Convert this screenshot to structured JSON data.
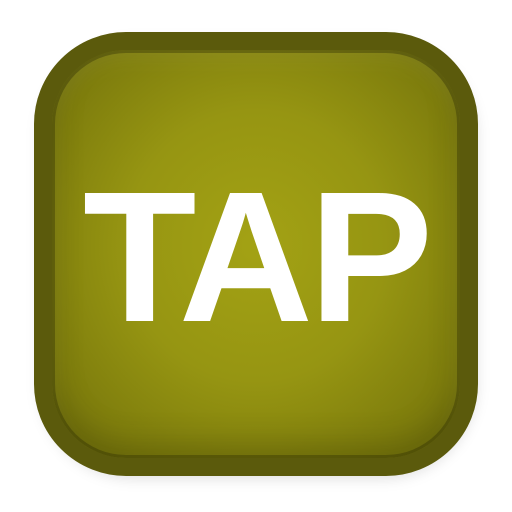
{
  "app_icon": {
    "label": "TAP",
    "colors": {
      "border": "#5b5a0c",
      "fill_center": "#a3a214",
      "fill_edge": "#706f0c",
      "text": "#ffffff"
    }
  }
}
